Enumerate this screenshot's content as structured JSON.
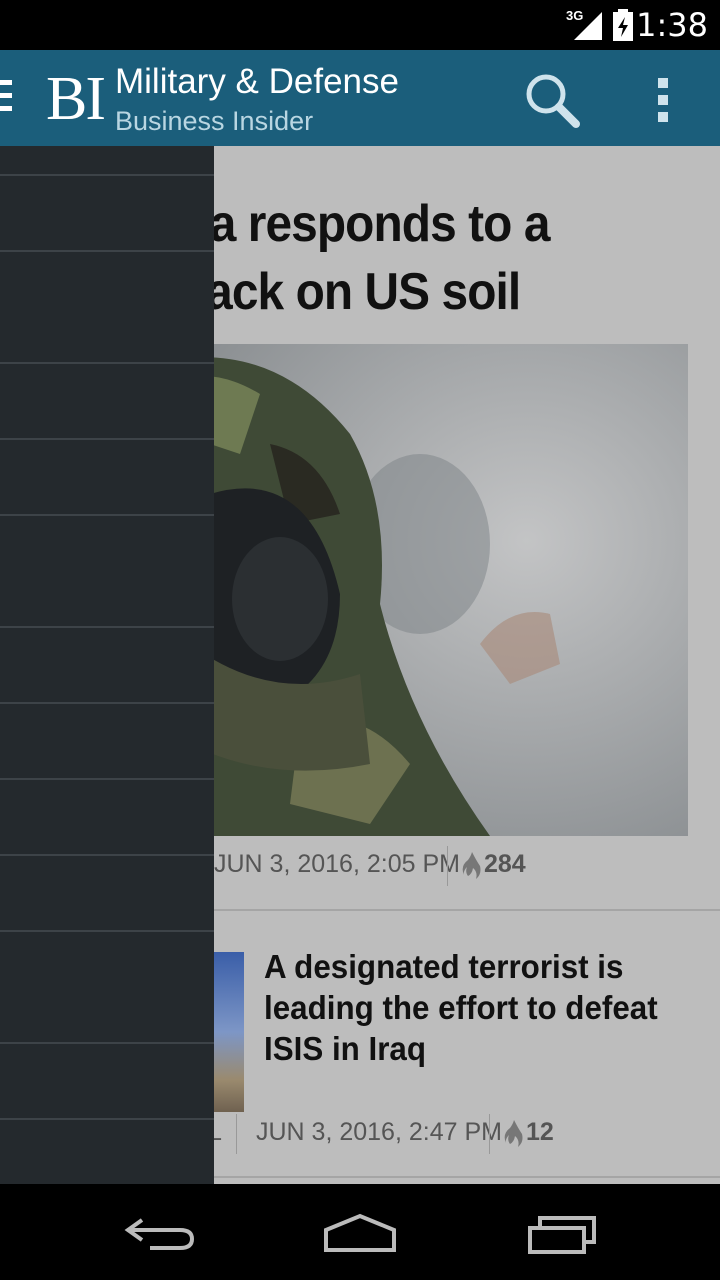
{
  "status_bar": {
    "network": "3G",
    "time": "1:38"
  },
  "action_bar": {
    "logo": "BI",
    "title": "Military & Defense",
    "subtitle": "Business Insider"
  },
  "articles": [
    {
      "headline_line1": "nerica responds to a",
      "headline_line2": "al attack on US soil",
      "timestamp": "JUN 3, 2016, 2:05 PM",
      "count": "284"
    },
    {
      "headline": "A designated terrorist is leading the effort to defeat ISIS in Iraq",
      "author_fragment": "L",
      "timestamp": "JUN 3, 2016, 2:47 PM",
      "count": "12"
    }
  ],
  "colors": {
    "action_bar": "#1b5e7b",
    "drawer": "#24292d",
    "content_bg": "#bdbdbd"
  }
}
